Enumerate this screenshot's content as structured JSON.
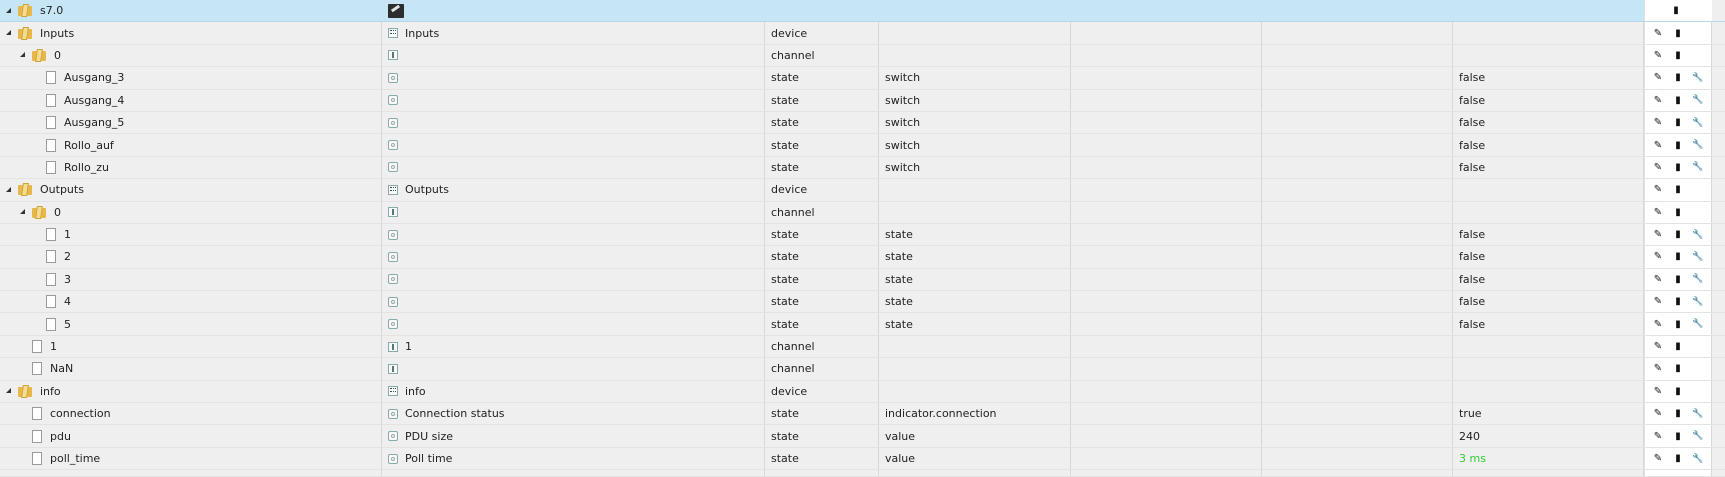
{
  "root": {
    "id": "s7.0"
  },
  "rows": [
    {
      "label": "Inputs",
      "level": 1,
      "kind": "folder",
      "name": "Inputs",
      "name_icon": "device-icon",
      "type": "device",
      "role": "",
      "value": "",
      "actions": [
        "edit",
        "delete"
      ]
    },
    {
      "label": "0",
      "level": 2,
      "kind": "folder",
      "name": "",
      "name_icon": "channel-icon",
      "type": "channel",
      "role": "",
      "value": "",
      "actions": [
        "edit",
        "delete"
      ]
    },
    {
      "label": "Ausgang_3",
      "level": 3,
      "kind": "file",
      "name": "",
      "name_icon": "state-icon",
      "type": "state",
      "role": "switch",
      "value": "false",
      "actions": [
        "edit",
        "delete",
        "wrench"
      ]
    },
    {
      "label": "Ausgang_4",
      "level": 3,
      "kind": "file",
      "name": "",
      "name_icon": "state-icon",
      "type": "state",
      "role": "switch",
      "value": "false",
      "actions": [
        "edit",
        "delete",
        "wrench"
      ]
    },
    {
      "label": "Ausgang_5",
      "level": 3,
      "kind": "file",
      "name": "",
      "name_icon": "state-icon",
      "type": "state",
      "role": "switch",
      "value": "false",
      "actions": [
        "edit",
        "delete",
        "wrench"
      ]
    },
    {
      "label": "Rollo_auf",
      "level": 3,
      "kind": "file",
      "name": "",
      "name_icon": "state-icon",
      "type": "state",
      "role": "switch",
      "value": "false",
      "actions": [
        "edit",
        "delete",
        "wrench"
      ]
    },
    {
      "label": "Rollo_zu",
      "level": 3,
      "kind": "file",
      "name": "",
      "name_icon": "state-icon",
      "type": "state",
      "role": "switch",
      "value": "false",
      "actions": [
        "edit",
        "delete",
        "wrench"
      ]
    },
    {
      "label": "Outputs",
      "level": 1,
      "kind": "folder",
      "name": "Outputs",
      "name_icon": "device-icon",
      "type": "device",
      "role": "",
      "value": "",
      "actions": [
        "edit",
        "delete"
      ]
    },
    {
      "label": "0",
      "level": 2,
      "kind": "folder",
      "name": "",
      "name_icon": "channel-icon",
      "type": "channel",
      "role": "",
      "value": "",
      "actions": [
        "edit",
        "delete"
      ]
    },
    {
      "label": "1",
      "level": 3,
      "kind": "file",
      "name": "",
      "name_icon": "state-icon",
      "type": "state",
      "role": "state",
      "value": "false",
      "actions": [
        "edit",
        "delete",
        "wrench"
      ]
    },
    {
      "label": "2",
      "level": 3,
      "kind": "file",
      "name": "",
      "name_icon": "state-icon",
      "type": "state",
      "role": "state",
      "value": "false",
      "actions": [
        "edit",
        "delete",
        "wrench"
      ]
    },
    {
      "label": "3",
      "level": 3,
      "kind": "file",
      "name": "",
      "name_icon": "state-icon",
      "type": "state",
      "role": "state",
      "value": "false",
      "actions": [
        "edit",
        "delete",
        "wrench"
      ]
    },
    {
      "label": "4",
      "level": 3,
      "kind": "file",
      "name": "",
      "name_icon": "state-icon",
      "type": "state",
      "role": "state",
      "value": "false",
      "actions": [
        "edit",
        "delete",
        "wrench"
      ]
    },
    {
      "label": "5",
      "level": 3,
      "kind": "file",
      "name": "",
      "name_icon": "state-icon",
      "type": "state",
      "role": "state",
      "value": "false",
      "actions": [
        "edit",
        "delete",
        "wrench"
      ]
    },
    {
      "label": "1",
      "level": 2,
      "kind": "file",
      "name": "1",
      "name_icon": "channel-icon",
      "type": "channel",
      "role": "",
      "value": "",
      "actions": [
        "edit",
        "delete"
      ]
    },
    {
      "label": "NaN",
      "level": 2,
      "kind": "file",
      "name": "",
      "name_icon": "channel-icon",
      "type": "channel",
      "role": "",
      "value": "",
      "actions": [
        "edit",
        "delete"
      ]
    },
    {
      "label": "info",
      "level": 1,
      "kind": "folder",
      "name": "info",
      "name_icon": "device-icon",
      "type": "device",
      "role": "",
      "value": "",
      "actions": [
        "edit",
        "delete"
      ]
    },
    {
      "label": "connection",
      "level": 2,
      "kind": "file",
      "name": "Connection status",
      "name_icon": "state-icon",
      "type": "state",
      "role": "indicator.connection",
      "value": "true",
      "actions": [
        "edit",
        "delete",
        "wrench"
      ]
    },
    {
      "label": "pdu",
      "level": 2,
      "kind": "file",
      "name": "PDU size",
      "name_icon": "state-icon",
      "type": "state",
      "role": "value",
      "value": "240",
      "actions": [
        "edit",
        "delete",
        "wrench"
      ]
    },
    {
      "label": "poll_time",
      "level": 2,
      "kind": "file",
      "name": "Poll time",
      "name_icon": "state-icon",
      "type": "state",
      "role": "value",
      "value": "3 ms",
      "value_color": "#33cc33",
      "actions": [
        "edit",
        "delete",
        "wrench"
      ]
    }
  ],
  "icons": {
    "edit": "pencil-icon",
    "delete": "trash-icon",
    "wrench": "wrench-icon"
  },
  "colors": {
    "root_row": "#c7e6f5",
    "row_bg": "#efefef",
    "value_green": "#33cc33"
  }
}
